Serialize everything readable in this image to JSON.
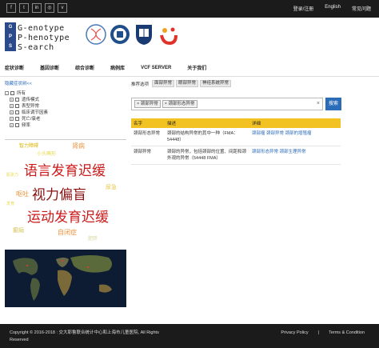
{
  "topbar": {
    "social": [
      "f",
      "t",
      "in",
      "◎",
      "v"
    ],
    "login": "登录/注册",
    "english": "English",
    "faq": "常见问题"
  },
  "logo": {
    "badge": "G P S",
    "line1": "G-enotype",
    "line2": "P-henotype",
    "line3": "S-earch"
  },
  "nav": [
    "症状诊断",
    "基因诊断",
    "综合诊断",
    "病例库",
    "VCF SERVER",
    "关于我们"
  ],
  "left": {
    "toggle": "隐藏症状树<<",
    "tree": [
      {
        "label": "所有",
        "indent": 0
      },
      {
        "label": "遗传模式",
        "indent": 1
      },
      {
        "label": "表型异常",
        "indent": 1
      },
      {
        "label": "临床调节因素",
        "indent": 1
      },
      {
        "label": "死亡/衰老",
        "indent": 1
      },
      {
        "label": "频率",
        "indent": 1
      }
    ],
    "cloud": [
      {
        "text": "智力障碍",
        "color": "#d8b400"
      },
      {
        "text": "肾病",
        "color": "#e8933a"
      },
      {
        "text": "小头畸形",
        "color": "#e8d84a"
      },
      {
        "text": "语言发育迟缓",
        "color": "#cc1a1a"
      },
      {
        "text": "视力偏盲",
        "color": "#8a1010"
      },
      {
        "text": "运动发育迟缓",
        "color": "#cc1a1a"
      },
      {
        "text": "呕吐",
        "color": "#e8933a"
      },
      {
        "text": "尿急",
        "color": "#e8c84a"
      },
      {
        "text": "自闭症",
        "color": "#e8933a"
      },
      {
        "text": "癫痫",
        "color": "#d4c65a"
      },
      {
        "text": "肌张力",
        "color": "#e8d84a"
      },
      {
        "text": "发育",
        "color": "#e8d84a"
      },
      {
        "text": "肥胖",
        "color": "#d8d8a0"
      }
    ]
  },
  "right": {
    "recommend_label": "推荐选项",
    "recommend_tags": [
      "面部异常",
      "眼部异常",
      "神经系统异常"
    ],
    "chips": [
      "颈部异常",
      "颈部形态异常"
    ],
    "clear": "×",
    "search_button": "搜索",
    "table": {
      "headers": [
        "名字",
        "描述",
        "详细"
      ],
      "rows": [
        {
          "name": "颈部形态异常",
          "desc": "颈部的结构异常的其中一种（FMA：54448）",
          "detail": "颈部瘤 颈部异常 颈部的增殖瘤"
        },
        {
          "name": "颈部异常",
          "desc": "颈部的异常，包括颈部的位置、间距和颈外观的异常（54448 FMA）",
          "detail": "颈部形态异常 颈部生理异常"
        }
      ]
    }
  },
  "footer": {
    "copyright": "Copyright © 2016-2018 : 交大耶鲁联合统计中心和上海市儿童医院, All Rights Reserved",
    "privacy": "Privacy Policy",
    "sep": "|",
    "terms": "Terms & Condition"
  }
}
